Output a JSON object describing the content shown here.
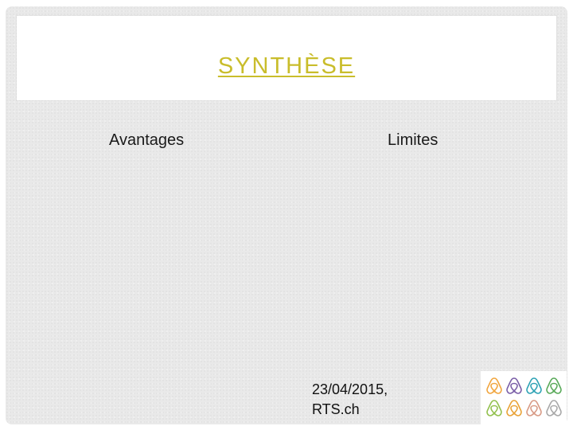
{
  "slide": {
    "title": "SYNTHÈSE",
    "title_color": "#c9bd2b",
    "columns": {
      "left_heading": "Avantages",
      "right_heading": "Limites"
    },
    "source": {
      "line1": "23/04/2015,",
      "line2": "RTS.ch"
    },
    "logo": {
      "icon": "airbnb-belo-icon",
      "colors": [
        "#f1a640",
        "#7b5fa8",
        "#2fa3b5",
        "#5aaa5a",
        "#93c14f",
        "#e9a338",
        "#d89b86",
        "#a9a9a9"
      ]
    }
  }
}
